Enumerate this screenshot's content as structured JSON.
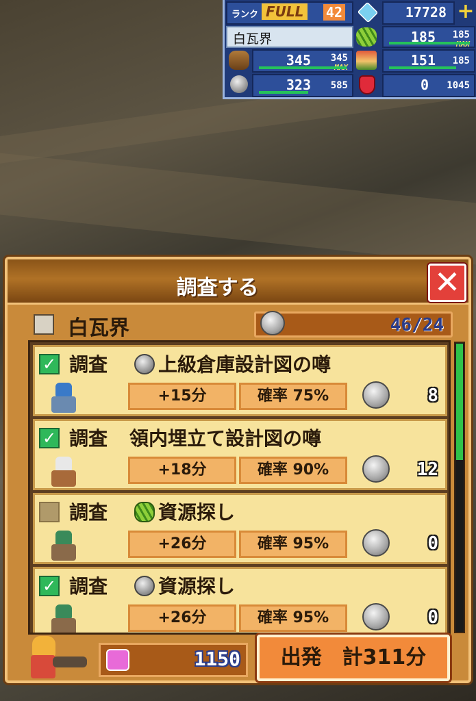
{
  "status": {
    "rank_label": "ランク",
    "full_label": "FULL",
    "rank_value": "42",
    "gems": "17728",
    "plus_icon": "plus-icon",
    "location": "白瓦界",
    "leaf_value": "185",
    "leaf_max": "185",
    "wood_value": "345",
    "wood_max": "345",
    "max_tag": "MAX",
    "food_value": "151",
    "food_max": "185",
    "coin_value": "323",
    "coin_max": "585",
    "ruby_value": "0",
    "ruby_max": "1045"
  },
  "dialog": {
    "title": "調査する",
    "close_symbol": "✕",
    "area_name": "白瓦界",
    "capacity": "46/24",
    "items": [
      {
        "checked": true,
        "command": "調査",
        "resource": "coin",
        "name": "上級倉庫設計図の噂",
        "time": "+15分",
        "prob": "確率 75%",
        "count": "8"
      },
      {
        "checked": true,
        "command": "調査",
        "resource": "none",
        "name": "領内埋立て設計図の噂",
        "time": "+18分",
        "prob": "確率 90%",
        "count": "12"
      },
      {
        "checked": false,
        "command": "調査",
        "resource": "leaf",
        "name": "資源探し",
        "time": "+26分",
        "prob": "確率 95%",
        "count": "0"
      },
      {
        "checked": true,
        "command": "調査",
        "resource": "coin",
        "name": "資源探し",
        "time": "+26分",
        "prob": "確率 95%",
        "count": "0"
      }
    ],
    "hearts": "1150",
    "depart": "出発　計311分"
  },
  "colors": {
    "status_bg": "#203a78",
    "dialog_bg": "#c98a3a",
    "card_bg": "#f7e39c",
    "check_green": "#2fb85a",
    "depart_orange": "#f28a3a",
    "close_red": "#e3403a"
  }
}
